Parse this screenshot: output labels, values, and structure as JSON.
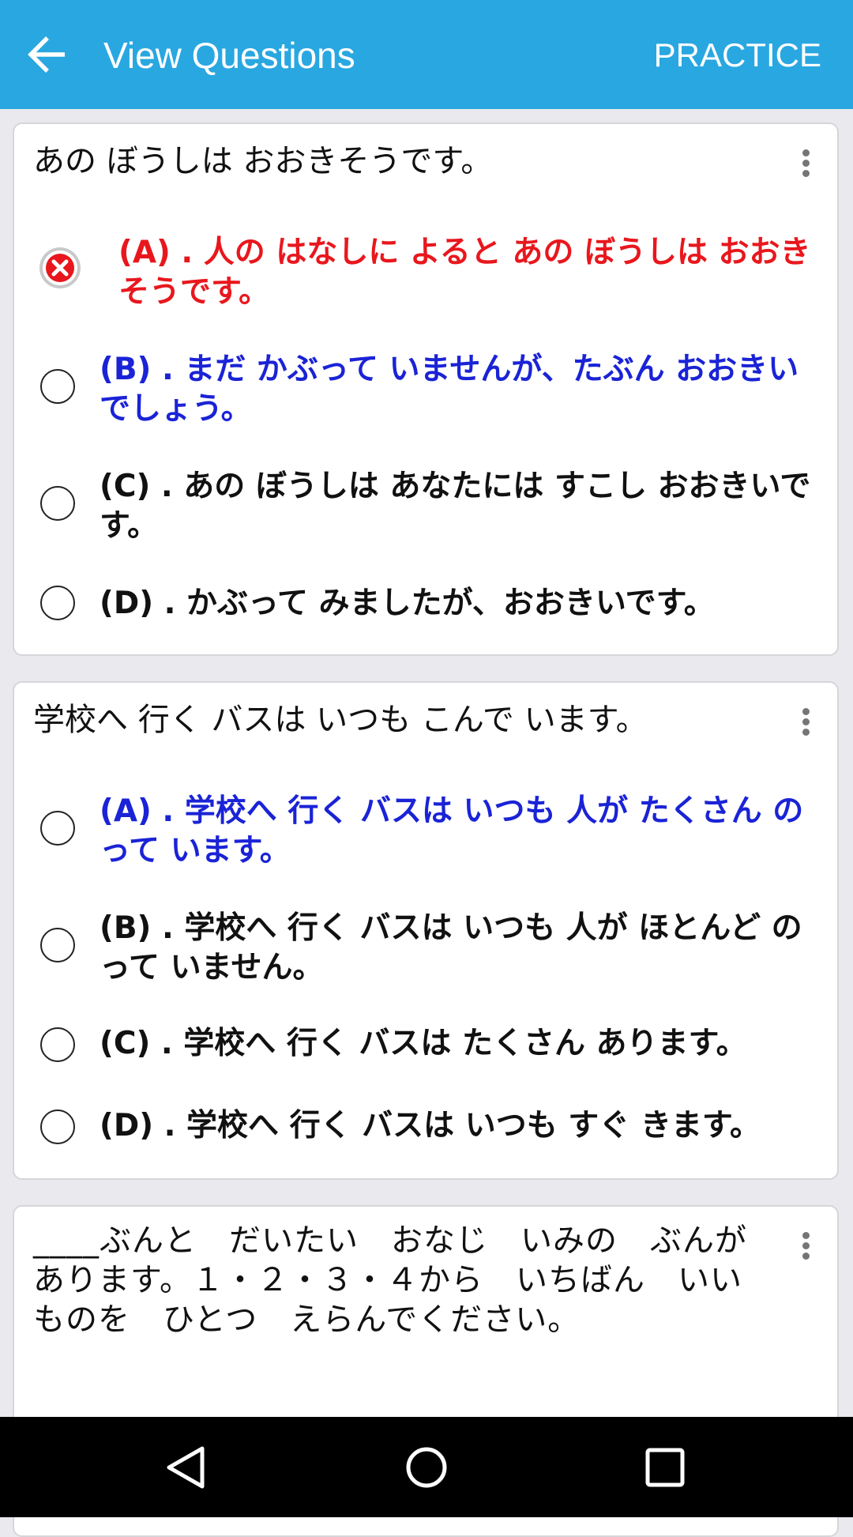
{
  "appbar": {
    "title": "View Questions",
    "action": "PRACTICE",
    "back_icon": "arrow-left-icon"
  },
  "colors": {
    "appbar": "#29a7e1",
    "wrong": "#e8171d",
    "correct": "#1a23d6",
    "background": "#e9e9ee"
  },
  "questions": [
    {
      "text": "あの ぼうしは おおきそうです。",
      "options": [
        {
          "label": "(A) . 人の はなしに よると あの ぼうしは おおきそうです。",
          "state": "wrong"
        },
        {
          "label": "(B) . まだ かぶって いませんが、たぶん おおきいでしょう。",
          "state": "correct"
        },
        {
          "label": "(C) . あの ぼうしは あなたには すこし おおきいです。",
          "state": "normal"
        },
        {
          "label": "(D) . かぶって みましたが、おおきいです。",
          "state": "normal"
        }
      ]
    },
    {
      "text": "学校へ 行く バスは いつも こんで います。",
      "options": [
        {
          "label": "(A) . 学校へ 行く バスは いつも 人が たくさん のって います。",
          "state": "correct"
        },
        {
          "label": "(B) . 学校へ 行く バスは いつも 人が ほとんど のって いません。",
          "state": "normal"
        },
        {
          "label": "(C) . 学校へ 行く バスは たくさん あります。",
          "state": "normal"
        },
        {
          "label": "(D) . 学校へ 行く バスは いつも すぐ きます。",
          "state": "normal"
        }
      ]
    },
    {
      "text": "____ぶんと　だいたい　おなじ　いみの　ぶんが　あります。１・２・３・４から　いちばん　いい　ものを　ひとつ　えらんでください。"
    }
  ],
  "navbar": {
    "back": "nav-back-icon",
    "home": "nav-home-icon",
    "recents": "nav-recents-icon"
  }
}
